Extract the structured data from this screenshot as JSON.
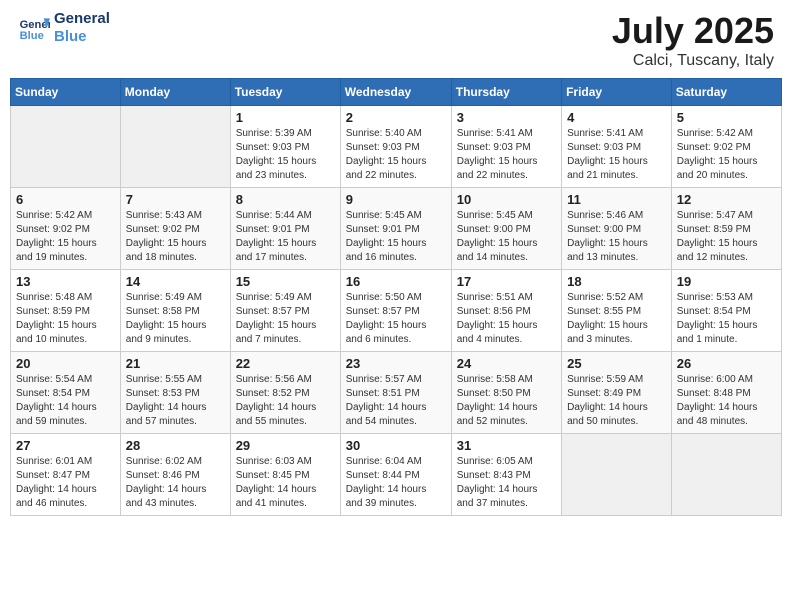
{
  "header": {
    "logo_line1": "General",
    "logo_line2": "Blue",
    "month": "July 2025",
    "location": "Calci, Tuscany, Italy"
  },
  "weekdays": [
    "Sunday",
    "Monday",
    "Tuesday",
    "Wednesday",
    "Thursday",
    "Friday",
    "Saturday"
  ],
  "weeks": [
    [
      {
        "day": "",
        "info": ""
      },
      {
        "day": "",
        "info": ""
      },
      {
        "day": "1",
        "info": "Sunrise: 5:39 AM\nSunset: 9:03 PM\nDaylight: 15 hours and 23 minutes."
      },
      {
        "day": "2",
        "info": "Sunrise: 5:40 AM\nSunset: 9:03 PM\nDaylight: 15 hours and 22 minutes."
      },
      {
        "day": "3",
        "info": "Sunrise: 5:41 AM\nSunset: 9:03 PM\nDaylight: 15 hours and 22 minutes."
      },
      {
        "day": "4",
        "info": "Sunrise: 5:41 AM\nSunset: 9:03 PM\nDaylight: 15 hours and 21 minutes."
      },
      {
        "day": "5",
        "info": "Sunrise: 5:42 AM\nSunset: 9:02 PM\nDaylight: 15 hours and 20 minutes."
      }
    ],
    [
      {
        "day": "6",
        "info": "Sunrise: 5:42 AM\nSunset: 9:02 PM\nDaylight: 15 hours and 19 minutes."
      },
      {
        "day": "7",
        "info": "Sunrise: 5:43 AM\nSunset: 9:02 PM\nDaylight: 15 hours and 18 minutes."
      },
      {
        "day": "8",
        "info": "Sunrise: 5:44 AM\nSunset: 9:01 PM\nDaylight: 15 hours and 17 minutes."
      },
      {
        "day": "9",
        "info": "Sunrise: 5:45 AM\nSunset: 9:01 PM\nDaylight: 15 hours and 16 minutes."
      },
      {
        "day": "10",
        "info": "Sunrise: 5:45 AM\nSunset: 9:00 PM\nDaylight: 15 hours and 14 minutes."
      },
      {
        "day": "11",
        "info": "Sunrise: 5:46 AM\nSunset: 9:00 PM\nDaylight: 15 hours and 13 minutes."
      },
      {
        "day": "12",
        "info": "Sunrise: 5:47 AM\nSunset: 8:59 PM\nDaylight: 15 hours and 12 minutes."
      }
    ],
    [
      {
        "day": "13",
        "info": "Sunrise: 5:48 AM\nSunset: 8:59 PM\nDaylight: 15 hours and 10 minutes."
      },
      {
        "day": "14",
        "info": "Sunrise: 5:49 AM\nSunset: 8:58 PM\nDaylight: 15 hours and 9 minutes."
      },
      {
        "day": "15",
        "info": "Sunrise: 5:49 AM\nSunset: 8:57 PM\nDaylight: 15 hours and 7 minutes."
      },
      {
        "day": "16",
        "info": "Sunrise: 5:50 AM\nSunset: 8:57 PM\nDaylight: 15 hours and 6 minutes."
      },
      {
        "day": "17",
        "info": "Sunrise: 5:51 AM\nSunset: 8:56 PM\nDaylight: 15 hours and 4 minutes."
      },
      {
        "day": "18",
        "info": "Sunrise: 5:52 AM\nSunset: 8:55 PM\nDaylight: 15 hours and 3 minutes."
      },
      {
        "day": "19",
        "info": "Sunrise: 5:53 AM\nSunset: 8:54 PM\nDaylight: 15 hours and 1 minute."
      }
    ],
    [
      {
        "day": "20",
        "info": "Sunrise: 5:54 AM\nSunset: 8:54 PM\nDaylight: 14 hours and 59 minutes."
      },
      {
        "day": "21",
        "info": "Sunrise: 5:55 AM\nSunset: 8:53 PM\nDaylight: 14 hours and 57 minutes."
      },
      {
        "day": "22",
        "info": "Sunrise: 5:56 AM\nSunset: 8:52 PM\nDaylight: 14 hours and 55 minutes."
      },
      {
        "day": "23",
        "info": "Sunrise: 5:57 AM\nSunset: 8:51 PM\nDaylight: 14 hours and 54 minutes."
      },
      {
        "day": "24",
        "info": "Sunrise: 5:58 AM\nSunset: 8:50 PM\nDaylight: 14 hours and 52 minutes."
      },
      {
        "day": "25",
        "info": "Sunrise: 5:59 AM\nSunset: 8:49 PM\nDaylight: 14 hours and 50 minutes."
      },
      {
        "day": "26",
        "info": "Sunrise: 6:00 AM\nSunset: 8:48 PM\nDaylight: 14 hours and 48 minutes."
      }
    ],
    [
      {
        "day": "27",
        "info": "Sunrise: 6:01 AM\nSunset: 8:47 PM\nDaylight: 14 hours and 46 minutes."
      },
      {
        "day": "28",
        "info": "Sunrise: 6:02 AM\nSunset: 8:46 PM\nDaylight: 14 hours and 43 minutes."
      },
      {
        "day": "29",
        "info": "Sunrise: 6:03 AM\nSunset: 8:45 PM\nDaylight: 14 hours and 41 minutes."
      },
      {
        "day": "30",
        "info": "Sunrise: 6:04 AM\nSunset: 8:44 PM\nDaylight: 14 hours and 39 minutes."
      },
      {
        "day": "31",
        "info": "Sunrise: 6:05 AM\nSunset: 8:43 PM\nDaylight: 14 hours and 37 minutes."
      },
      {
        "day": "",
        "info": ""
      },
      {
        "day": "",
        "info": ""
      }
    ]
  ]
}
